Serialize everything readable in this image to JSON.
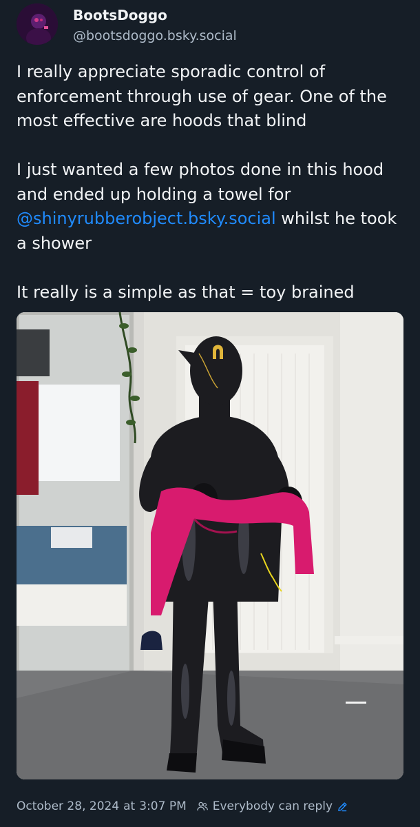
{
  "author": {
    "display_name": "BootsDoggo",
    "handle": "@bootsdoggo.bsky.social",
    "avatar_icon": "avatar"
  },
  "post": {
    "paragraph_1": "I really appreciate sporadic control of enforcement through use of gear.  One of the most effective are hoods that blind",
    "paragraph_2_before": "I just wanted a few photos done in this hood and ended up holding a towel for ",
    "paragraph_2_mention": "@shinyrubberobject.bsky.social",
    "paragraph_2_after": " whilst he took a shower",
    "paragraph_3": "It really is a simple as that = toy brained"
  },
  "footer": {
    "date": "October 28, 2024",
    "at": "at",
    "time": "3:07 PM",
    "reply_setting": "Everybody can reply",
    "people_icon": "people-icon",
    "edit_icon": "pencil-icon"
  },
  "colors": {
    "background": "#161e27",
    "text": "#f1f3f5",
    "muted": "#aebbc9",
    "link": "#208bfe",
    "towel": "#d81b6e"
  }
}
